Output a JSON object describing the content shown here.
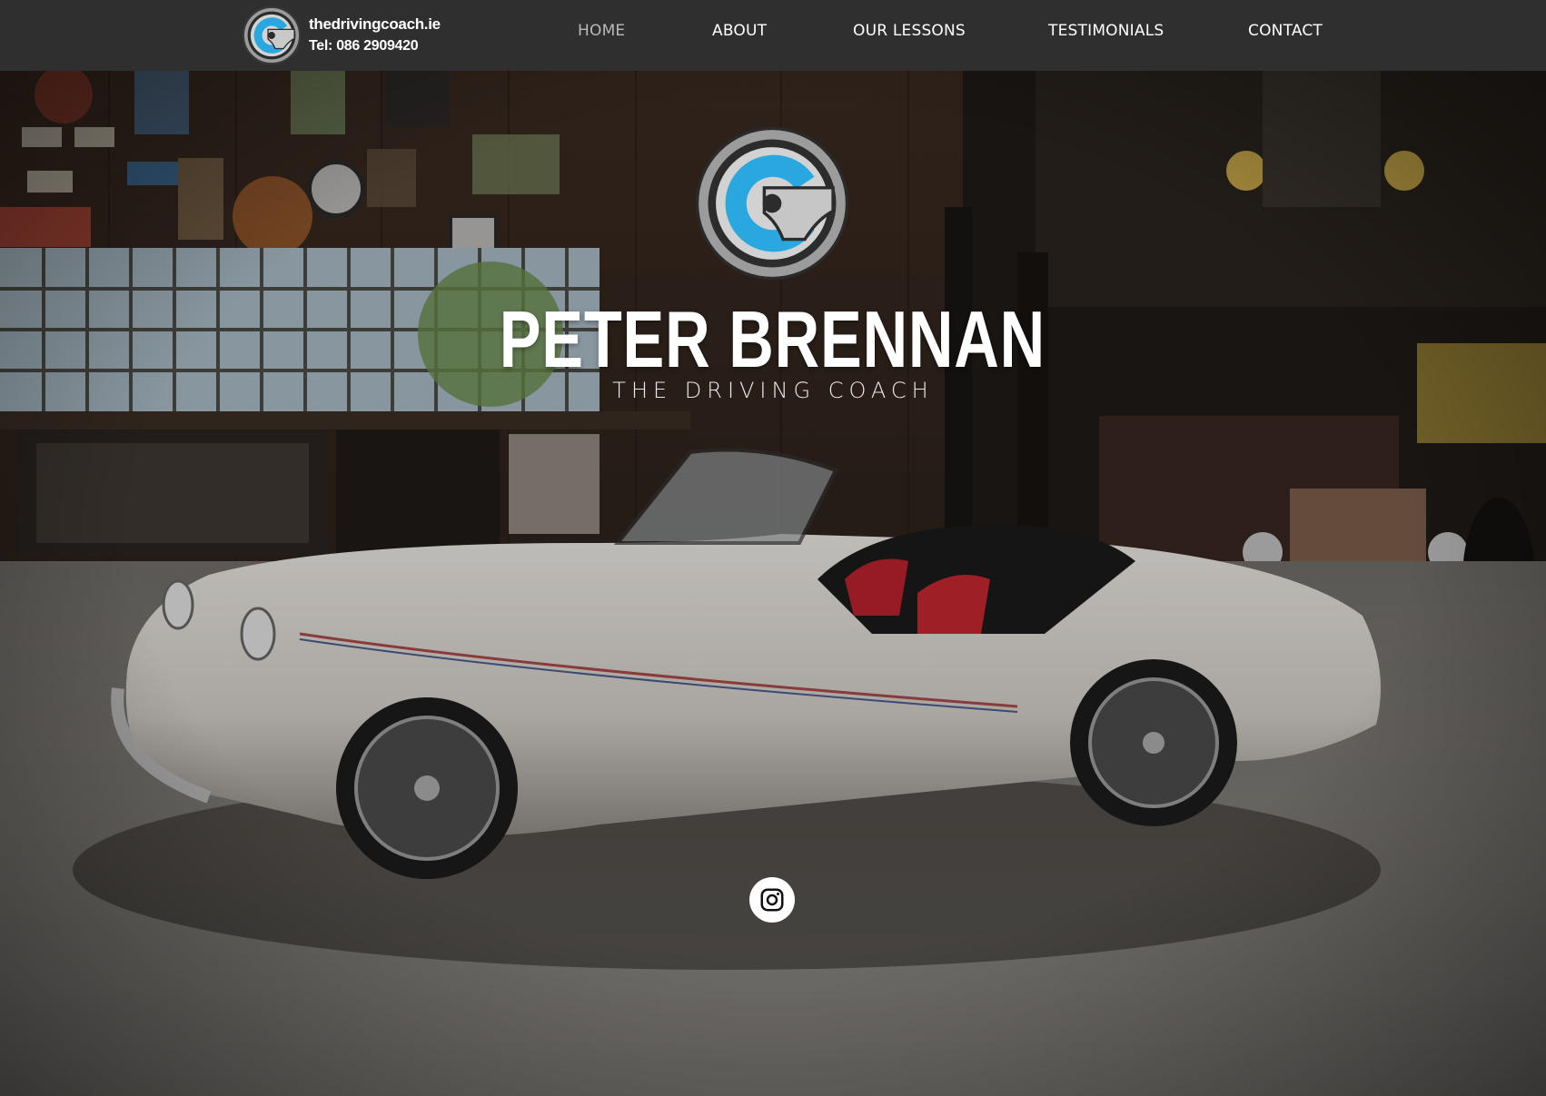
{
  "brand": {
    "site": "thedrivingcoach.ie",
    "tel": "Tel: 086 2909420",
    "logo_icon": "steering-wheel-c-logo"
  },
  "nav": {
    "items": [
      {
        "label": "HOME",
        "active": true
      },
      {
        "label": "ABOUT",
        "active": false
      },
      {
        "label": "OUR LESSONS",
        "active": false
      },
      {
        "label": "TESTIMONIALS",
        "active": false
      },
      {
        "label": "CONTACT",
        "active": false
      }
    ]
  },
  "hero": {
    "title": "PETER BRENNAN",
    "subtitle": "THE DRIVING COACH",
    "background": "vintage-convertible-in-garage-photo",
    "social_icon": "instagram-icon"
  },
  "colors": {
    "topbar": "#2f2f2f",
    "accent_blue": "#29a8e0",
    "logo_grey": "#a9a9a9",
    "nav_active": "#b9b9b9",
    "text": "#ffffff"
  }
}
